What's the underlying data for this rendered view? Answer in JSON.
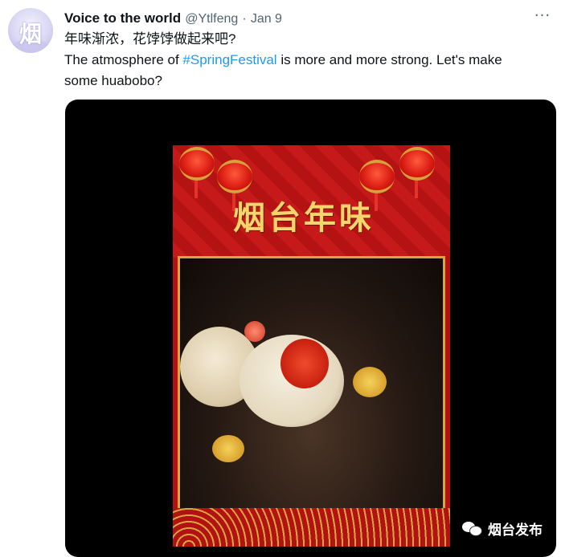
{
  "tweet": {
    "author_name": "Voice to the world",
    "handle": "@Ytlfeng",
    "separator": "·",
    "date": "Jan 9",
    "more_label": "···",
    "avatar_glyph": "烟",
    "text_line1": "年味渐浓，花饽饽做起来吧?",
    "text_line2_before": "The atmosphere of ",
    "hashtag": "#SpringFestival",
    "text_line2_after": "  is more and more strong. Let's make",
    "text_line3": "some huabobo?"
  },
  "media": {
    "poster_title": "烟台年味",
    "watermark": "烟台发布",
    "watermark_icon": "wechat-icon"
  },
  "colors": {
    "hashtag": "#1d9bf0",
    "secondary_text": "#536471",
    "primary_text": "#0f1419",
    "poster_red": "#b31212",
    "poster_gold": "#d8a63e"
  }
}
